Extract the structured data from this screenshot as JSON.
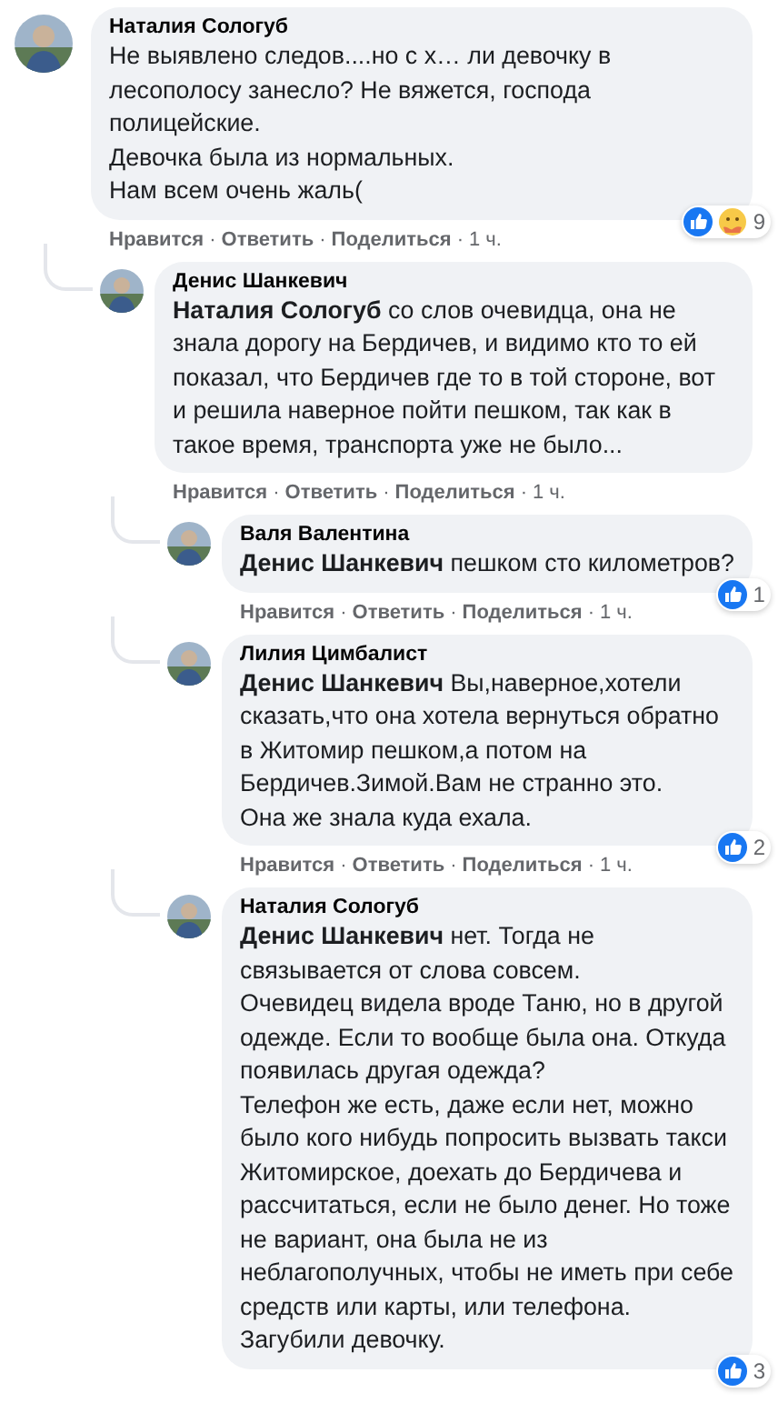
{
  "comments": [
    {
      "author": "Наталия Сологуб",
      "avatar": {
        "kind": "picture"
      },
      "paragraphs": [
        "Не выявлено следов....но с х… ли девочку в лесополосу занесло? Не вяжется, господа полицейские.",
        "Девочка была из нормальных.",
        "Нам всем очень жаль("
      ],
      "actions": [
        "Нравится",
        "Ответить",
        "Поделиться",
        "1 ч."
      ],
      "separator": "·",
      "reactions": {
        "icons": [
          {
            "kind": "like"
          },
          {
            "kind": "care"
          }
        ],
        "count": "9"
      },
      "children": [
        {
          "author": "Денис Шанкевич",
          "avatar": {
            "kind": "picture"
          },
          "paragraphs": [
            "**Наталия Сологуб** со слов очевидца, она не знала дорогу на Бердичев, и видимо кто то ей показал, что Бердичев где то в той стороне, вот и решила наверное пойти пешком, так как в такое время, транспорта уже не было..."
          ],
          "actions": [
            "Нравится",
            "Ответить",
            "Поделиться",
            "1 ч."
          ],
          "separator": "·",
          "children": [
            {
              "author": "Валя Валентина",
              "avatar": {
                "kind": "picture"
              },
              "paragraphs": [
                "**Денис Шанкевич** пешком сто километров?"
              ],
              "actions": [
                "Нравится",
                "Ответить",
                "Поделиться",
                "1 ч."
              ],
              "separator": "·",
              "reactions": {
                "icons": [
                  {
                    "kind": "like"
                  }
                ],
                "count": "1"
              }
            },
            {
              "author": "Лилия Цимбалист",
              "avatar": {
                "kind": "picture"
              },
              "paragraphs": [
                "**Денис Шанкевич** Вы,наверное,хотели сказать,что она хотела вернуться обратно в Житомир пешком,а потом на Бердичев.Зимой.Вам не странно это.",
                "Она же знала куда ехала."
              ],
              "actions": [
                "Нравится",
                "Ответить",
                "Поделиться",
                "1 ч."
              ],
              "separator": "·",
              "reactions": {
                "icons": [
                  {
                    "kind": "like"
                  }
                ],
                "count": "2"
              }
            },
            {
              "author": "Наталия Сологуб",
              "avatar": {
                "kind": "picture"
              },
              "paragraphs": [
                "**Денис Шанкевич** нет. Тогда не связывается от слова совсем.",
                "Очевидец видела вроде Таню, но в другой одежде. Если то вообще была она. Откуда появилась другая одежда?",
                "Телефон же есть, даже если нет, можно было кого нибудь попросить вызвать такси Житомирское, доехать до Бердичева и рассчитаться, если не было денег. Но тоже не вариант, она была не из неблагополучных, чтобы не иметь при себе средств или карты, или телефона.",
                "Загубили девочку."
              ],
              "reactions": {
                "icons": [
                  {
                    "kind": "like"
                  }
                ],
                "count": "3"
              }
            }
          ]
        }
      ]
    }
  ]
}
